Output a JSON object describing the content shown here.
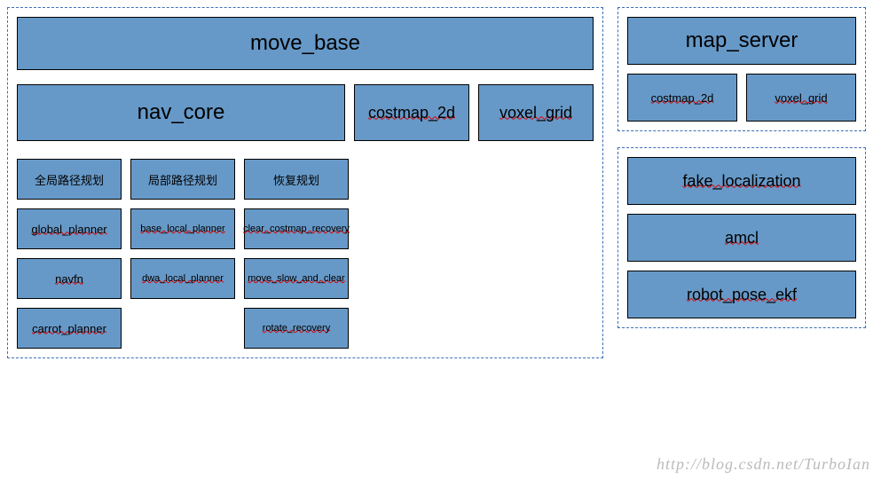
{
  "left": {
    "move_base": "move_base",
    "nav_core": "nav_core",
    "costmap_2d": "costmap_2d",
    "voxel_grid": "voxel_grid",
    "planner_headers": {
      "global": "全局路径规划",
      "local": "局部路径规划",
      "recovery": "恢复规划"
    },
    "planners": {
      "global": [
        "global_planner",
        "navfn",
        "carrot_planner"
      ],
      "local": [
        "base_local_planner",
        "dwa_local_planner"
      ],
      "recovery": [
        "clear_costmap_recovery",
        "move_slow_and_clear",
        "rotate_recovery"
      ]
    }
  },
  "right": {
    "map_server": {
      "title": "map_server",
      "children": [
        "costmap_2d",
        "voxel_grid"
      ]
    },
    "localization": [
      "fake_localization",
      "amcl",
      "robot_pose_ekf"
    ]
  },
  "watermark": "http://blog.csdn.net/TurboIan"
}
